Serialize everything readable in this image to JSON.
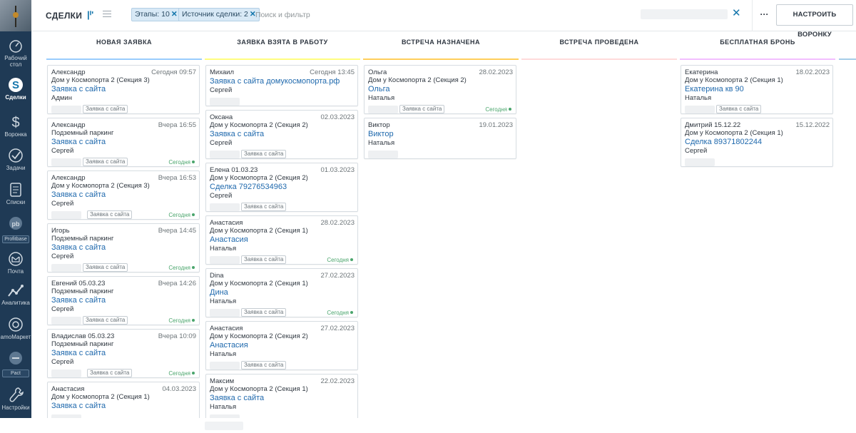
{
  "header": {
    "title": "СДЕЛКИ",
    "search_placeholder": "Поиск и фильтр",
    "filters": [
      {
        "label": "Этапы: 10"
      },
      {
        "label": "Источник сделки: 2"
      }
    ],
    "more_label": "···",
    "setup_label": "НАСТРОИТЬ ВОРОНКУ"
  },
  "nav": [
    {
      "label": "Рабочий стол",
      "icon": "dashboard-icon"
    },
    {
      "label": "Сделки",
      "icon": "deals-icon",
      "active": true
    },
    {
      "label": "Воронка",
      "icon": "funnel-icon"
    },
    {
      "label": "Задачи",
      "icon": "tasks-icon"
    },
    {
      "label": "Списки",
      "icon": "lists-icon"
    },
    {
      "label": "Profitbase",
      "icon": "profitbase-icon"
    },
    {
      "label": "Почта",
      "icon": "mail-icon"
    },
    {
      "label": "Аналитика",
      "icon": "analytics-icon"
    },
    {
      "label": "amoМаркет",
      "icon": "market-icon"
    },
    {
      "label": "Pact",
      "icon": "pact-icon"
    },
    {
      "label": "Настройки",
      "icon": "settings-icon"
    }
  ],
  "columns": [
    {
      "title": "НОВАЯ ЗАЯВКА",
      "color": "#99ccfd",
      "cards": [
        {
          "name": "Александр",
          "date": "Сегодня 09:57",
          "sub": "Дом у Космопорта 2 (Секция 3)",
          "deal": "Заявка с сайта",
          "person": "Админ",
          "tag": "Заявка с сайта",
          "today": ""
        },
        {
          "name": "Александр",
          "date": "Вчера 16:55",
          "sub": "Подземный паркинг",
          "deal": "Заявка с сайта",
          "person": "Сергей",
          "tag": "Заявка с сайта",
          "today": "Сегодня"
        },
        {
          "name": "Александр",
          "date": "Вчера 16:53",
          "sub": "Дом у Космопорта 2 (Секция 3)",
          "deal": "Заявка с сайта",
          "person": "Сергей",
          "tag": "Заявка с сайта",
          "today": "Сегодня"
        },
        {
          "name": "Игорь",
          "date": "Вчера 14:45",
          "sub": "Подземный паркинг",
          "deal": "Заявка с сайта",
          "person": "Сергей",
          "tag": "Заявка с сайта",
          "today": "Сегодня"
        },
        {
          "name": "Евгений 05.03.23",
          "date": "Вчера 14:26",
          "sub": "Подземный паркинг",
          "deal": "Заявка с сайта",
          "person": "Сергей",
          "tag": "Заявка с сайта",
          "today": "Сегодня"
        },
        {
          "name": "Владислав 05.03.23",
          "date": "Вчера 10:09",
          "sub": "Подземный паркинг",
          "deal": "Заявка с сайта",
          "person": "Сергей",
          "tag": "Заявка с сайта",
          "today": "Сегодня"
        },
        {
          "name": "Анастасия",
          "date": "04.03.2023",
          "sub": "Дом у Космопорта 2 (Секция 1)",
          "deal": "Заявка с сайта",
          "person": "",
          "tag": "",
          "today": ""
        }
      ]
    },
    {
      "title": "ЗАЯВКА ВЗЯТА В РАБОТУ",
      "color": "#fffd7f",
      "cards": [
        {
          "name": "Михаил",
          "date": "Сегодня 13:45",
          "sub": "",
          "deal": "Заявка с сайта домукосмопорта.рф",
          "person": "Сергей",
          "tag": "",
          "today": ""
        },
        {
          "name": "Оксана",
          "date": "02.03.2023",
          "sub": "Дом у Космопорта 2 (Секция 2)",
          "deal": "Заявка с сайта",
          "person": "Сергей",
          "tag": "Заявка с сайта",
          "today": ""
        },
        {
          "name": "Елена 01.03.23",
          "date": "01.03.2023",
          "sub": "Дом у Космопорта 2 (Секция 2)",
          "deal": "Сделка 79276534963",
          "person": "Сергей",
          "tag": "Заявка с сайта",
          "today": ""
        },
        {
          "name": "Анастасия",
          "date": "28.02.2023",
          "sub": "Дом у Космопорта 2 (Секция 1)",
          "deal": "Анастасия",
          "person": "Наталья",
          "tag": "Заявка с сайта",
          "today": "Сегодня"
        },
        {
          "name": "Dina",
          "date": "27.02.2023",
          "sub": "Дом у Космопорта 2 (Секция 1)",
          "deal": "Дина",
          "person": "Наталья",
          "tag": "Заявка с сайта",
          "today": "Сегодня"
        },
        {
          "name": "Анастасия",
          "date": "27.02.2023",
          "sub": "Дом у Космопорта 2 (Секция 2)",
          "deal": "Анастасия",
          "person": "Наталья",
          "tag": "Заявка с сайта",
          "today": ""
        },
        {
          "name": "Максим",
          "date": "22.02.2023",
          "sub": "Дом у Космопорта 2 (Секция 1)",
          "deal": "Заявка с сайта",
          "person": "Наталья",
          "tag": "",
          "today": ""
        }
      ]
    },
    {
      "title": "ВСТРЕЧА НАЗНАЧЕНА",
      "color": "#ffce5a",
      "cards": [
        {
          "name": "Ольга",
          "date": "28.02.2023",
          "sub": "Дом у Космопорта 2 (Секция 2)",
          "deal": "Ольга",
          "person": "Наталья",
          "tag": "Заявка с сайта",
          "today": "Сегодня"
        },
        {
          "name": "Виктор",
          "date": "19.01.2023",
          "sub": "",
          "deal": "Виктор",
          "person": "Наталья",
          "tag": "",
          "today": ""
        }
      ]
    },
    {
      "title": "ВСТРЕЧА ПРОВЕДЕНА",
      "color": "#ffdbdb",
      "cards": []
    },
    {
      "title": "БЕСПЛАТНАЯ БРОНЬ",
      "color": "#f3beff",
      "cards": [
        {
          "name": "Екатерина",
          "date": "18.02.2023",
          "sub": "Дом у Космопорта 2 (Секция 1)",
          "deal": "Екатерина кв 90",
          "person": "Наталья",
          "tag": "Заявка с сайта",
          "today": ""
        },
        {
          "name": "Дмитрий 15.12.22",
          "date": "15.12.2022",
          "sub": "Дом у Космопорта 2 (Секция 1)",
          "deal": "Сделка 89371802244",
          "person": "Сергей",
          "tag": "",
          "today": ""
        }
      ]
    }
  ]
}
